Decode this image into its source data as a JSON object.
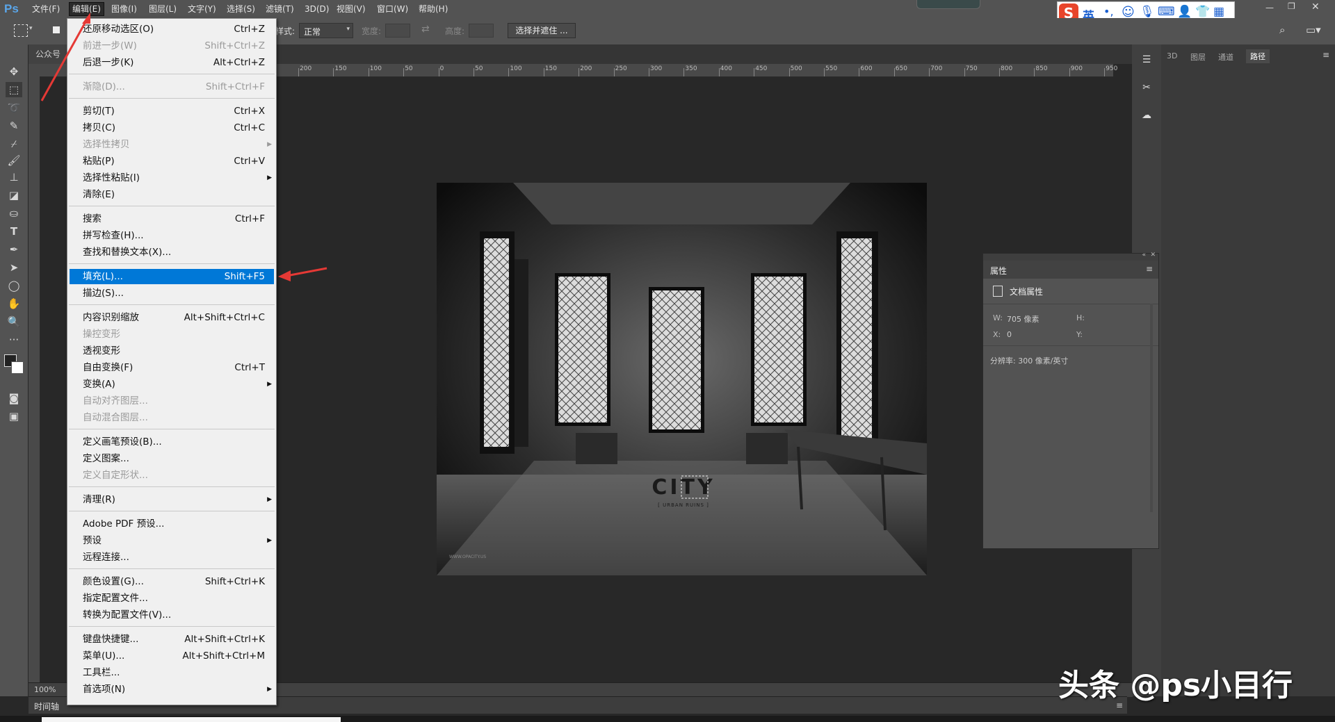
{
  "menubar": {
    "logo": "Ps",
    "items": [
      "文件(F)",
      "编辑(E)",
      "图像(I)",
      "图层(L)",
      "文字(Y)",
      "选择(S)",
      "滤镜(T)",
      "3D(D)",
      "视图(V)",
      "窗口(W)",
      "帮助(H)"
    ]
  },
  "optionsbar": {
    "style_label": "样式:",
    "style_value": "正常",
    "width_label": "宽度:",
    "height_label": "高度:",
    "select_mask_button": "选择并遮住 ..."
  },
  "document": {
    "tab": "公众号",
    "zoom": "100%",
    "timeline": "时间轴"
  },
  "ruler": {
    "h_ticks": [
      "200",
      "150",
      "100",
      "50",
      "0",
      "50",
      "100",
      "150",
      "200",
      "250",
      "300",
      "350",
      "400",
      "450",
      "500",
      "550",
      "600",
      "650",
      "700",
      "750",
      "800",
      "850",
      "900",
      "950"
    ]
  },
  "photo": {
    "watermark_text": "CITY",
    "watermark_sub": "[ URBAN RUINS ]",
    "site": "WWW.OPACITY.US"
  },
  "edit_menu": {
    "groups": [
      [
        {
          "label": "还原移动选区(O)",
          "shortcut": "Ctrl+Z",
          "disabled": false
        },
        {
          "label": "前进一步(W)",
          "shortcut": "Shift+Ctrl+Z",
          "disabled": true
        },
        {
          "label": "后退一步(K)",
          "shortcut": "Alt+Ctrl+Z",
          "disabled": false
        }
      ],
      [
        {
          "label": "渐隐(D)...",
          "shortcut": "Shift+Ctrl+F",
          "disabled": true
        }
      ],
      [
        {
          "label": "剪切(T)",
          "shortcut": "Ctrl+X",
          "disabled": false
        },
        {
          "label": "拷贝(C)",
          "shortcut": "Ctrl+C",
          "disabled": false
        },
        {
          "label": "选择性拷贝",
          "shortcut": "",
          "disabled": true,
          "submenu": true
        },
        {
          "label": "粘贴(P)",
          "shortcut": "Ctrl+V",
          "disabled": false
        },
        {
          "label": "选择性粘贴(I)",
          "shortcut": "",
          "disabled": false,
          "submenu": true
        },
        {
          "label": "清除(E)",
          "shortcut": "",
          "disabled": false
        }
      ],
      [
        {
          "label": "搜索",
          "shortcut": "Ctrl+F",
          "disabled": false
        },
        {
          "label": "拼写检查(H)...",
          "shortcut": "",
          "disabled": false
        },
        {
          "label": "查找和替换文本(X)...",
          "shortcut": "",
          "disabled": false
        }
      ],
      [
        {
          "label": "填充(L)...",
          "shortcut": "Shift+F5",
          "disabled": false,
          "highlighted": true
        },
        {
          "label": "描边(S)...",
          "shortcut": "",
          "disabled": false
        }
      ],
      [
        {
          "label": "内容识别缩放",
          "shortcut": "Alt+Shift+Ctrl+C",
          "disabled": false
        },
        {
          "label": "操控变形",
          "shortcut": "",
          "disabled": true
        },
        {
          "label": "透视变形",
          "shortcut": "",
          "disabled": false
        },
        {
          "label": "自由变换(F)",
          "shortcut": "Ctrl+T",
          "disabled": false
        },
        {
          "label": "变换(A)",
          "shortcut": "",
          "disabled": false,
          "submenu": true
        },
        {
          "label": "自动对齐图层...",
          "shortcut": "",
          "disabled": true
        },
        {
          "label": "自动混合图层...",
          "shortcut": "",
          "disabled": true
        }
      ],
      [
        {
          "label": "定义画笔预设(B)...",
          "shortcut": "",
          "disabled": false
        },
        {
          "label": "定义图案...",
          "shortcut": "",
          "disabled": false
        },
        {
          "label": "定义自定形状...",
          "shortcut": "",
          "disabled": true
        }
      ],
      [
        {
          "label": "清理(R)",
          "shortcut": "",
          "disabled": false,
          "submenu": true
        }
      ],
      [
        {
          "label": "Adobe PDF 预设...",
          "shortcut": "",
          "disabled": false
        },
        {
          "label": "预设",
          "shortcut": "",
          "disabled": false,
          "submenu": true
        },
        {
          "label": "远程连接...",
          "shortcut": "",
          "disabled": false
        }
      ],
      [
        {
          "label": "颜色设置(G)...",
          "shortcut": "Shift+Ctrl+K",
          "disabled": false
        },
        {
          "label": "指定配置文件...",
          "shortcut": "",
          "disabled": false
        },
        {
          "label": "转换为配置文件(V)...",
          "shortcut": "",
          "disabled": false
        }
      ],
      [
        {
          "label": "键盘快捷键...",
          "shortcut": "Alt+Shift+Ctrl+K",
          "disabled": false
        },
        {
          "label": "菜单(U)...",
          "shortcut": "Alt+Shift+Ctrl+M",
          "disabled": false
        },
        {
          "label": "工具栏...",
          "shortcut": "",
          "disabled": false
        },
        {
          "label": "首选项(N)",
          "shortcut": "",
          "disabled": false,
          "submenu": true
        }
      ]
    ]
  },
  "right_panel": {
    "tabs": [
      "3D",
      "图层",
      "通道",
      "路径"
    ],
    "active_tab": "路径"
  },
  "properties": {
    "title": "属性",
    "section": "文档属性",
    "w_label": "W:",
    "w_value": "705 像素",
    "h_label": "H:",
    "x_label": "X:",
    "x_value": "0",
    "y_label": "Y:",
    "resolution": "分辨率: 300 像素/英寸"
  },
  "ime": {
    "mode": "英"
  },
  "overlay_watermark": "头条 @ps小目行",
  "colors": {
    "highlight": "#0078d7",
    "arrow": "#e53935",
    "ps_blue": "#5aa6ea"
  }
}
